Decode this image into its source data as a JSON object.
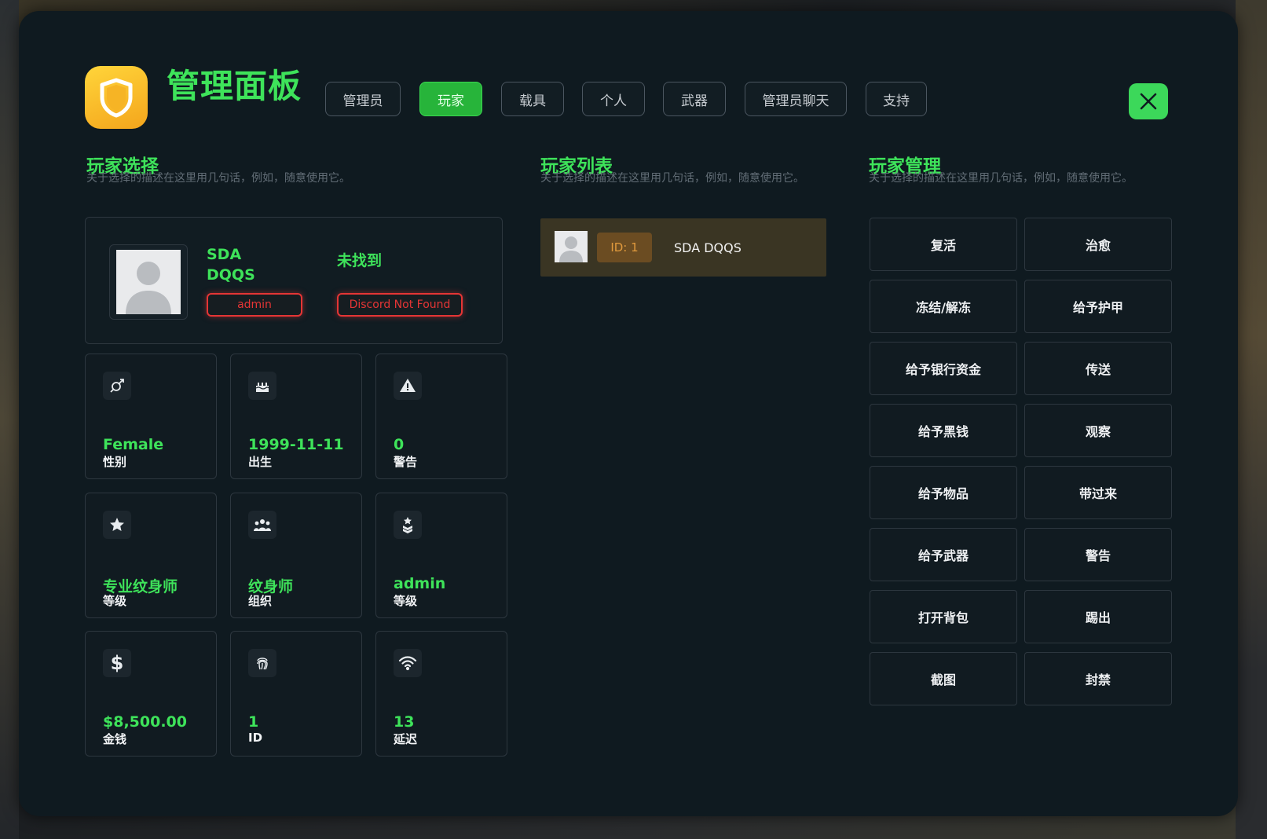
{
  "header": {
    "title": "管理面板",
    "tabs": [
      {
        "label": "管理员"
      },
      {
        "label": "玩家",
        "active": true
      },
      {
        "label": "载具"
      },
      {
        "label": "个人"
      },
      {
        "label": "武器"
      },
      {
        "label": "管理员聊天"
      },
      {
        "label": "支持"
      }
    ]
  },
  "sections": {
    "player_select": {
      "title": "玩家选择",
      "desc": "关于选择的描述在这里用几句话，例如，随意使用它。"
    },
    "player_list": {
      "title": "玩家列表",
      "desc": "关于选择的描述在这里用几句话，例如，随意使用它。"
    },
    "player_manage": {
      "title": "玩家管理",
      "desc": "关于选择的描述在这里用几句话，例如，随意使用它。"
    }
  },
  "profile": {
    "name": "SDA DQQS",
    "discord_status": "未找到",
    "role_badge": "admin",
    "discord_badge": "Discord Not Found"
  },
  "stats": [
    {
      "icon": "gender-icon",
      "value": "Female",
      "label": "性别"
    },
    {
      "icon": "birthday-cake-icon",
      "value": "1999-11-11",
      "label": "出生"
    },
    {
      "icon": "warning-icon",
      "value": "0",
      "label": "警告"
    },
    {
      "icon": "star-icon",
      "value": "专业纹身师",
      "label": "等级"
    },
    {
      "icon": "group-icon",
      "value": "纹身师",
      "label": "组织"
    },
    {
      "icon": "rank-icon",
      "value": "admin",
      "label": "等级"
    },
    {
      "icon": "dollar-icon",
      "value": "$8,500.00",
      "label": "金钱"
    },
    {
      "icon": "fingerprint-icon",
      "value": "1",
      "label": "ID"
    },
    {
      "icon": "wifi-icon",
      "value": "13",
      "label": "延迟"
    }
  ],
  "player_list": [
    {
      "id_label": "ID: 1",
      "name": "SDA DQQS"
    }
  ],
  "actions": [
    "复活",
    "治愈",
    "冻结/解冻",
    "给予护甲",
    "给予银行资金",
    "传送",
    "给予黑钱",
    "观察",
    "给予物品",
    "带过来",
    "给予武器",
    "警告",
    "打开背包",
    "踢出",
    "截图",
    "封禁"
  ],
  "colors": {
    "accent": "#3ee35a",
    "panel_bg": "#0f1a20",
    "danger": "#e53535",
    "id_badge": "#e19a3d"
  }
}
